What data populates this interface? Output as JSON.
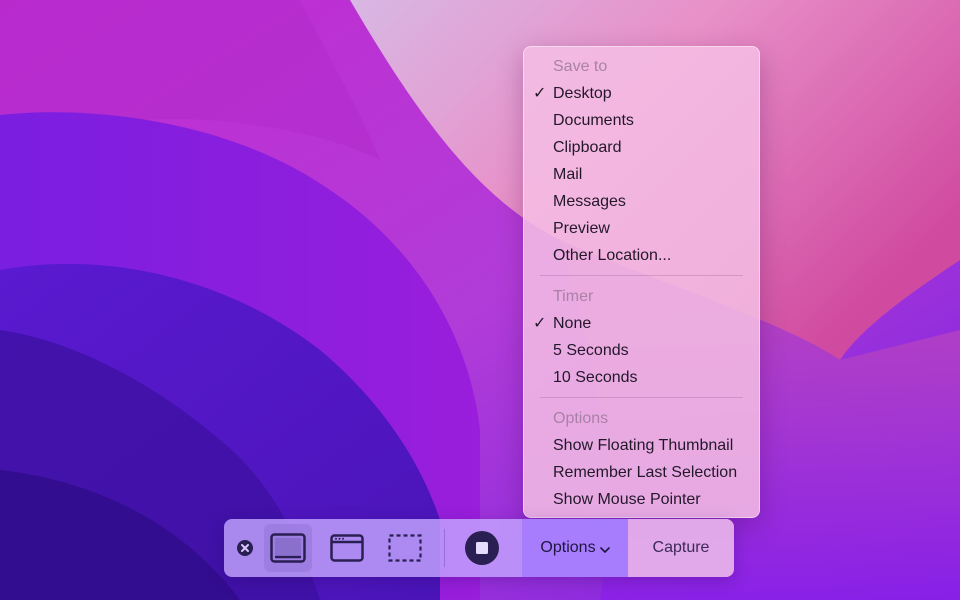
{
  "menu": {
    "sections": [
      {
        "header": "Save to",
        "items": [
          {
            "label": "Desktop",
            "checked": true
          },
          {
            "label": "Documents",
            "checked": false
          },
          {
            "label": "Clipboard",
            "checked": false
          },
          {
            "label": "Mail",
            "checked": false
          },
          {
            "label": "Messages",
            "checked": false
          },
          {
            "label": "Preview",
            "checked": false
          },
          {
            "label": "Other Location...",
            "checked": false
          }
        ]
      },
      {
        "header": "Timer",
        "items": [
          {
            "label": "None",
            "checked": true
          },
          {
            "label": "5 Seconds",
            "checked": false
          },
          {
            "label": "10 Seconds",
            "checked": false
          }
        ]
      },
      {
        "header": "Options",
        "items": [
          {
            "label": "Show Floating Thumbnail",
            "checked": false
          },
          {
            "label": "Remember Last Selection",
            "checked": false
          },
          {
            "label": "Show Mouse Pointer",
            "checked": false
          }
        ]
      }
    ],
    "check_glyph": "✓"
  },
  "toolbar": {
    "options_label": "Options",
    "capture_label": "Capture",
    "selected_mode": "capture-entire-screen",
    "icons": {
      "close": "close-circle-icon",
      "screen": "capture-entire-screen-icon",
      "window": "capture-window-icon",
      "selection": "capture-selection-icon",
      "record": "record-screen-icon",
      "chevron": "chevron-down-icon"
    }
  },
  "colors": {
    "accent": "#a278ff",
    "icon_dark": "#2a1f52",
    "menu_text": "#23182a",
    "menu_header": "#a882a6"
  }
}
